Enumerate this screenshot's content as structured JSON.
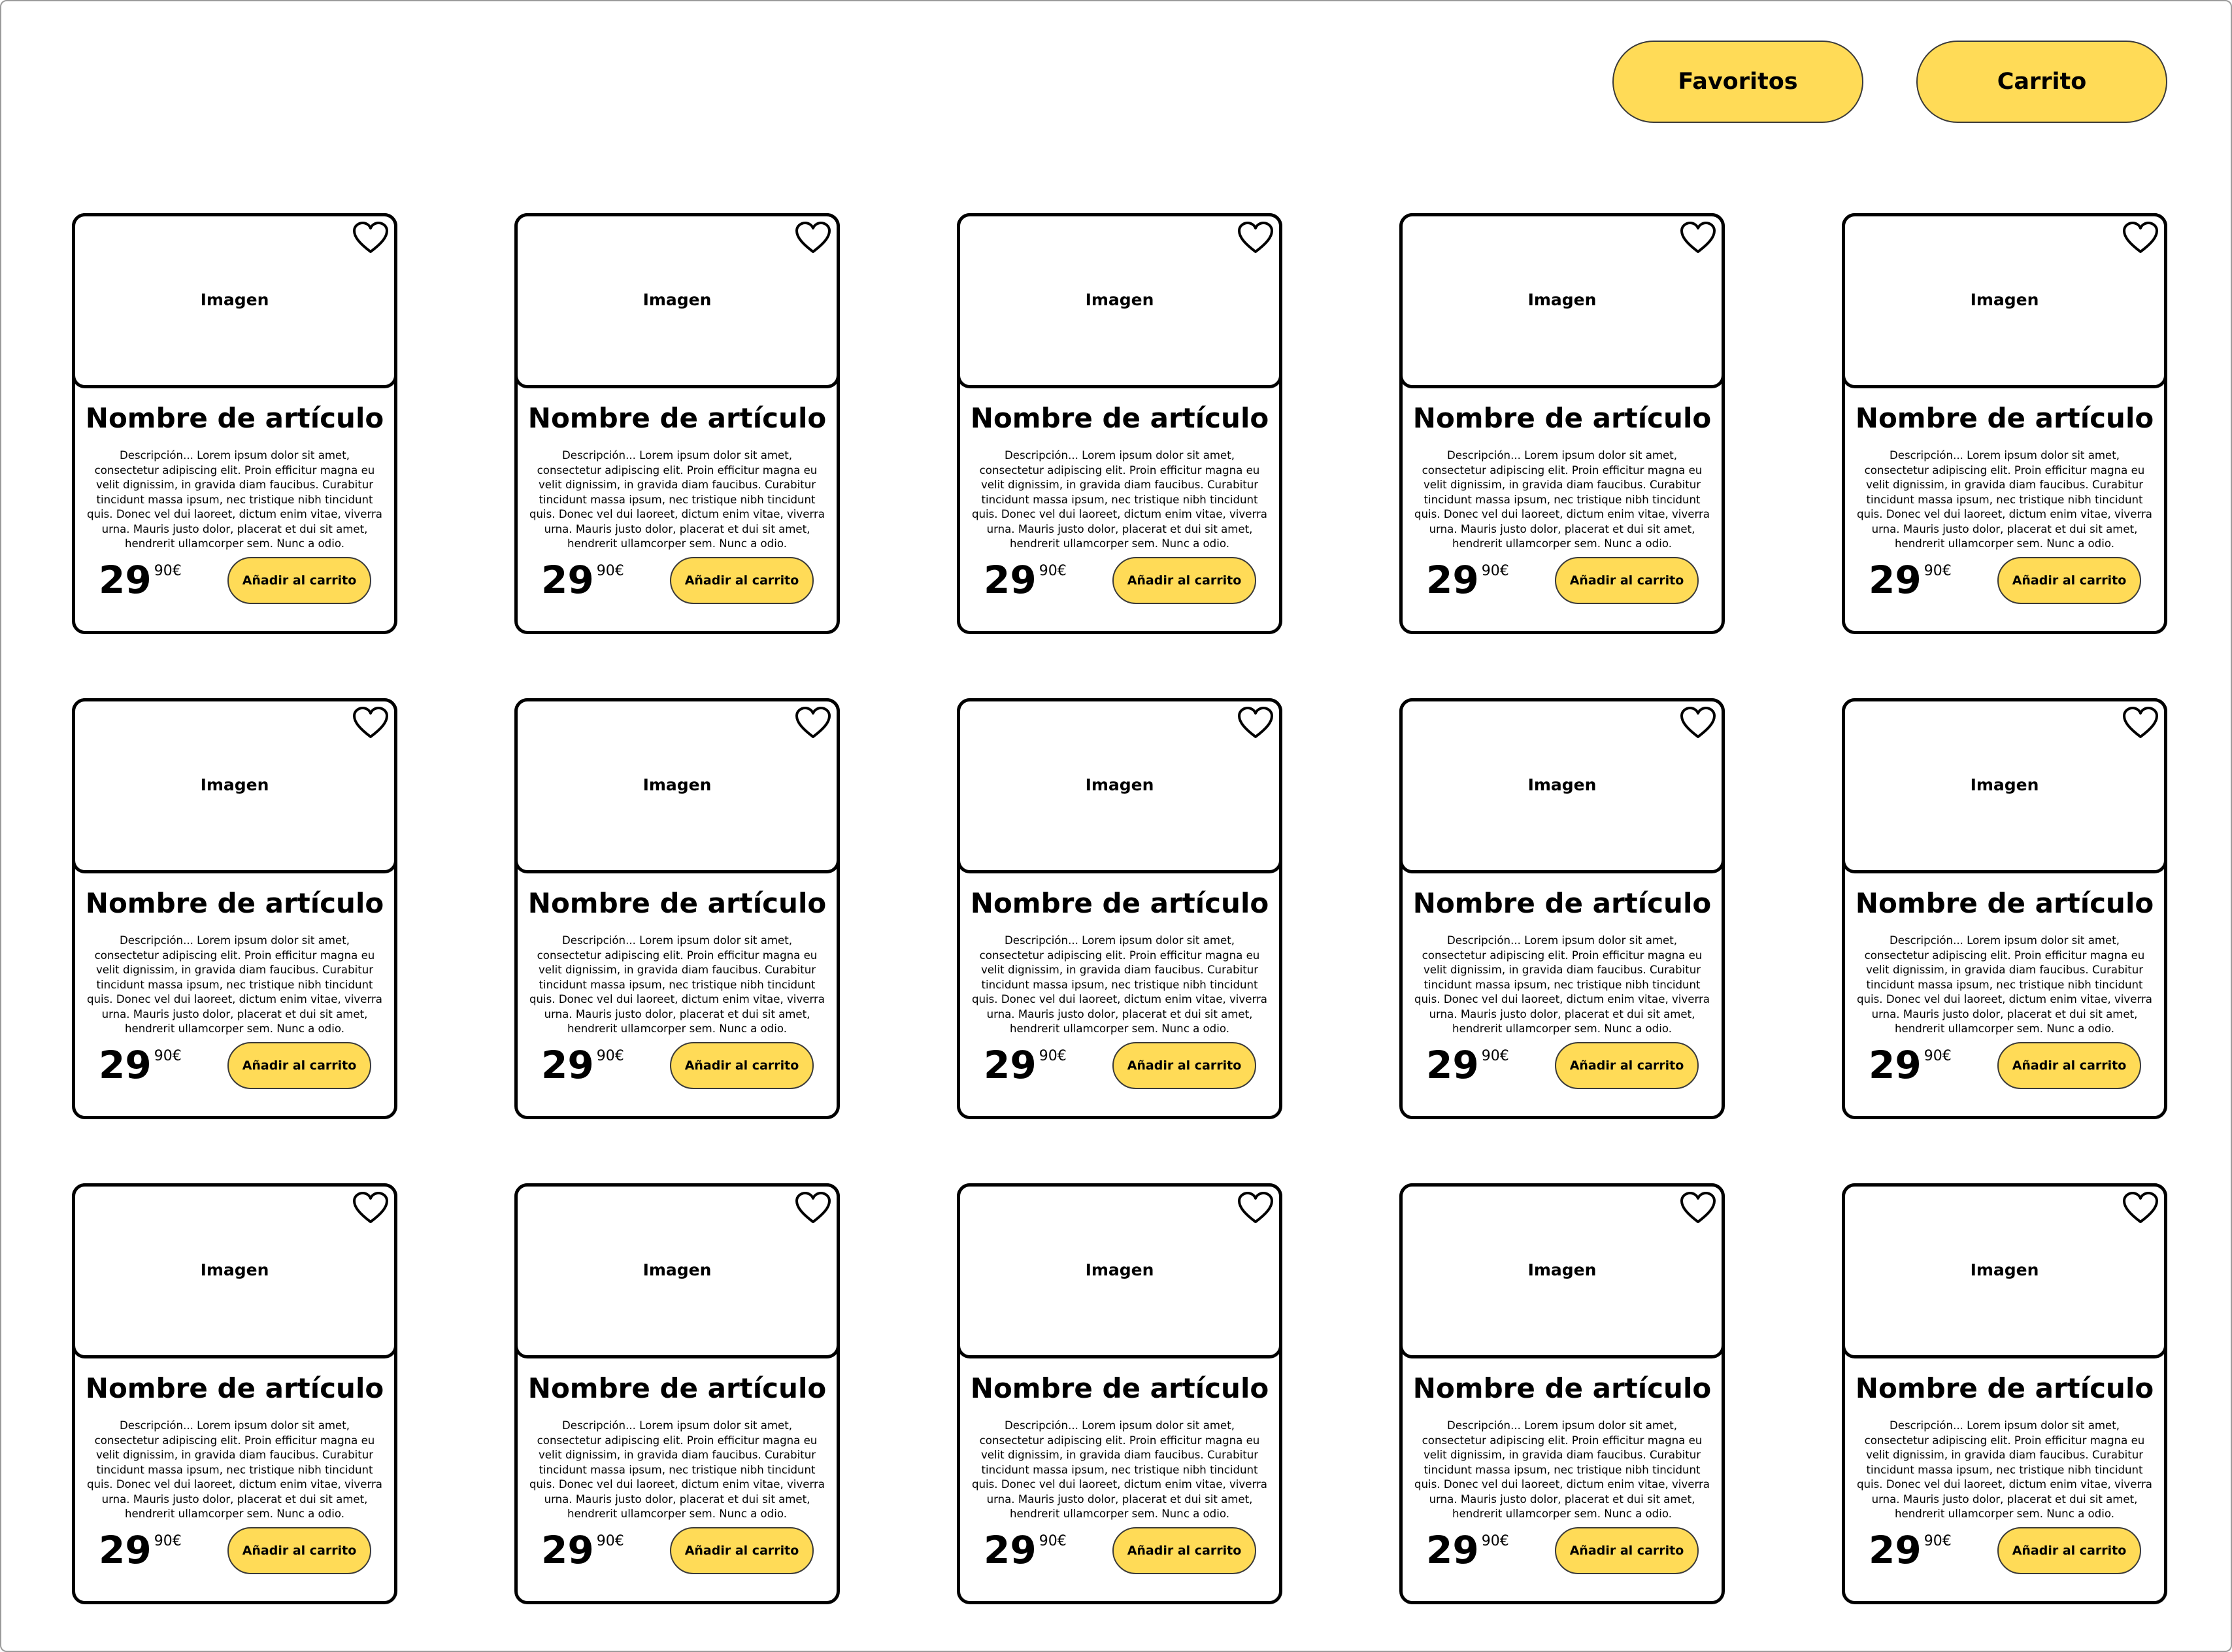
{
  "header": {
    "favorites_label": "Favoritos",
    "cart_label": "Carrito"
  },
  "colors": {
    "accent": "#ffdb57",
    "border": "#000000",
    "frame": "#9a9a9a"
  },
  "card_template": {
    "image_label": "Imagen",
    "name": "Nombre de artículo",
    "description": "Descripción... Lorem ipsum dolor sit amet, consectetur adipiscing elit. Proin efficitur magna eu velit dignissim, in gravida diam faucibus. Curabitur tincidunt massa ipsum, nec tristique nibh tincidunt quis. Donec vel dui laoreet, dictum enim vitae, viverra urna. Mauris justo dolor, placerat et dui sit amet, hendrerit ullamcorper sem. Nunc a odio.",
    "price_integer": "29",
    "price_decimal": "90€",
    "add_to_cart_label": "Añadir al carrito",
    "favorite_icon": "heart-outline-icon"
  },
  "grid": {
    "rows": 3,
    "columns": 5
  },
  "products": [
    {},
    {},
    {},
    {},
    {},
    {},
    {},
    {},
    {},
    {},
    {},
    {},
    {},
    {},
    {}
  ]
}
